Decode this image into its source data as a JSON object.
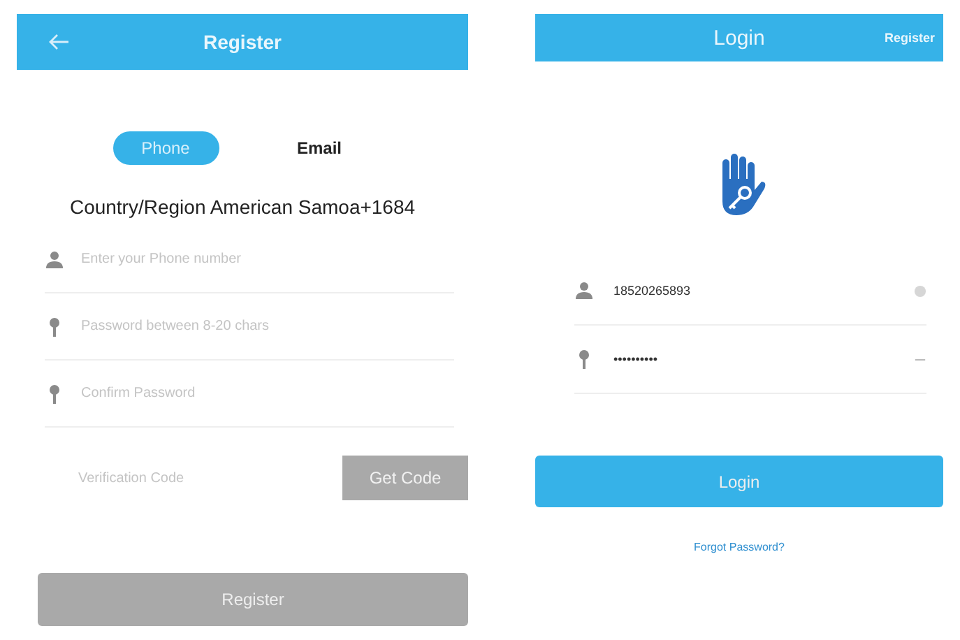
{
  "register": {
    "title": "Register",
    "tabs": [
      {
        "label": "Phone",
        "selected": true
      },
      {
        "label": "Email",
        "selected": false
      }
    ],
    "country_region": "Country/Region American Samoa+1684",
    "fields": [
      {
        "kind": "person",
        "placeholder": "Enter your Phone number"
      },
      {
        "kind": "key",
        "placeholder": "Password between 8-20 chars"
      },
      {
        "kind": "key",
        "placeholder": "Confirm Password"
      }
    ],
    "verification": {
      "placeholder": "Verification Code",
      "button": "Get Code",
      "disabled": true
    },
    "submit": {
      "label": "Register",
      "disabled": true
    }
  },
  "login": {
    "title": "Login",
    "register_link": "Register",
    "fields": [
      {
        "kind": "person",
        "value": "18520265893"
      },
      {
        "kind": "key",
        "value": "••••••••••"
      }
    ],
    "submit": {
      "label": "Login"
    },
    "forgot_link": "Forgot Password?"
  }
}
